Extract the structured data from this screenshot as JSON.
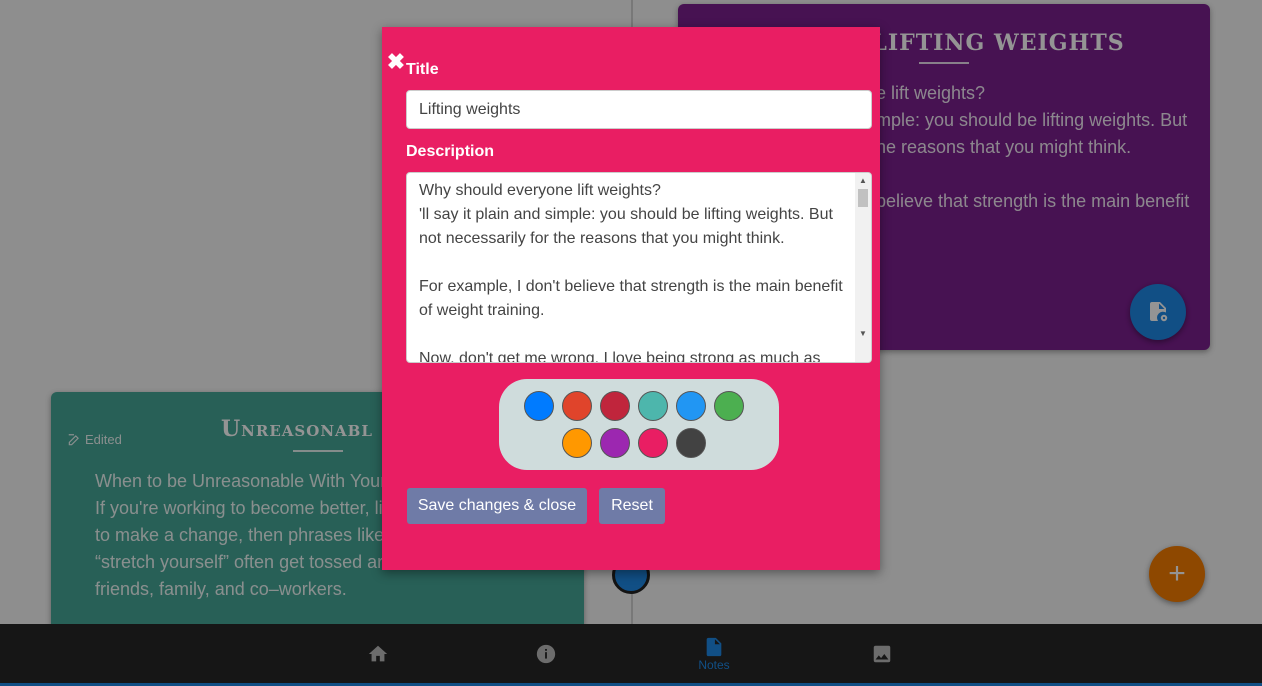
{
  "background": {
    "notes": [
      {
        "title": "LIFTING WEIGHTS",
        "body": "e lift weights?\nmple: you should be lifting weights. But\nhe reasons that you might think.\n\nbelieve that strength is the main benefit",
        "color": "#7b1f8e"
      },
      {
        "title": "Unreasonabl",
        "edited_label": "Edited",
        "body": "When to be Unreasonable With Yours\nIf you're working to become better, liv\nto make a change, then phrases like “\n“stretch yourself” often get tossed ar\nfriends, family, and co–workers.",
        "color": "#46a597"
      }
    ],
    "add_button_label": "+"
  },
  "bottom_nav": {
    "items": [
      {
        "icon": "home-icon",
        "label": ""
      },
      {
        "icon": "info-icon",
        "label": ""
      },
      {
        "icon": "note-icon",
        "label": "Notes"
      },
      {
        "icon": "image-icon",
        "label": ""
      }
    ],
    "active_index": 2
  },
  "modal": {
    "close_label": "✖",
    "title_label": "Title",
    "title_value": "Lifting weights",
    "description_label": "Description",
    "description_value": "Why should everyone lift weights?\n'll say it plain and simple: you should be lifting weights. But not necessarily for the reasons that you might think.\n\nFor example, I don't believe that strength is the main benefit of weight training.\n\nNow, don't get me wrong, I love being strong as much as",
    "palette": [
      "#007bff",
      "#e0442b",
      "#c0253c",
      "#4db6ac",
      "#2196f3",
      "#4caf50",
      "#ff9800",
      "#9c27b0",
      "#e91e63",
      "#424242"
    ],
    "save_label": "Save changes & close",
    "reset_label": "Reset",
    "background_color": "#e91e63"
  }
}
